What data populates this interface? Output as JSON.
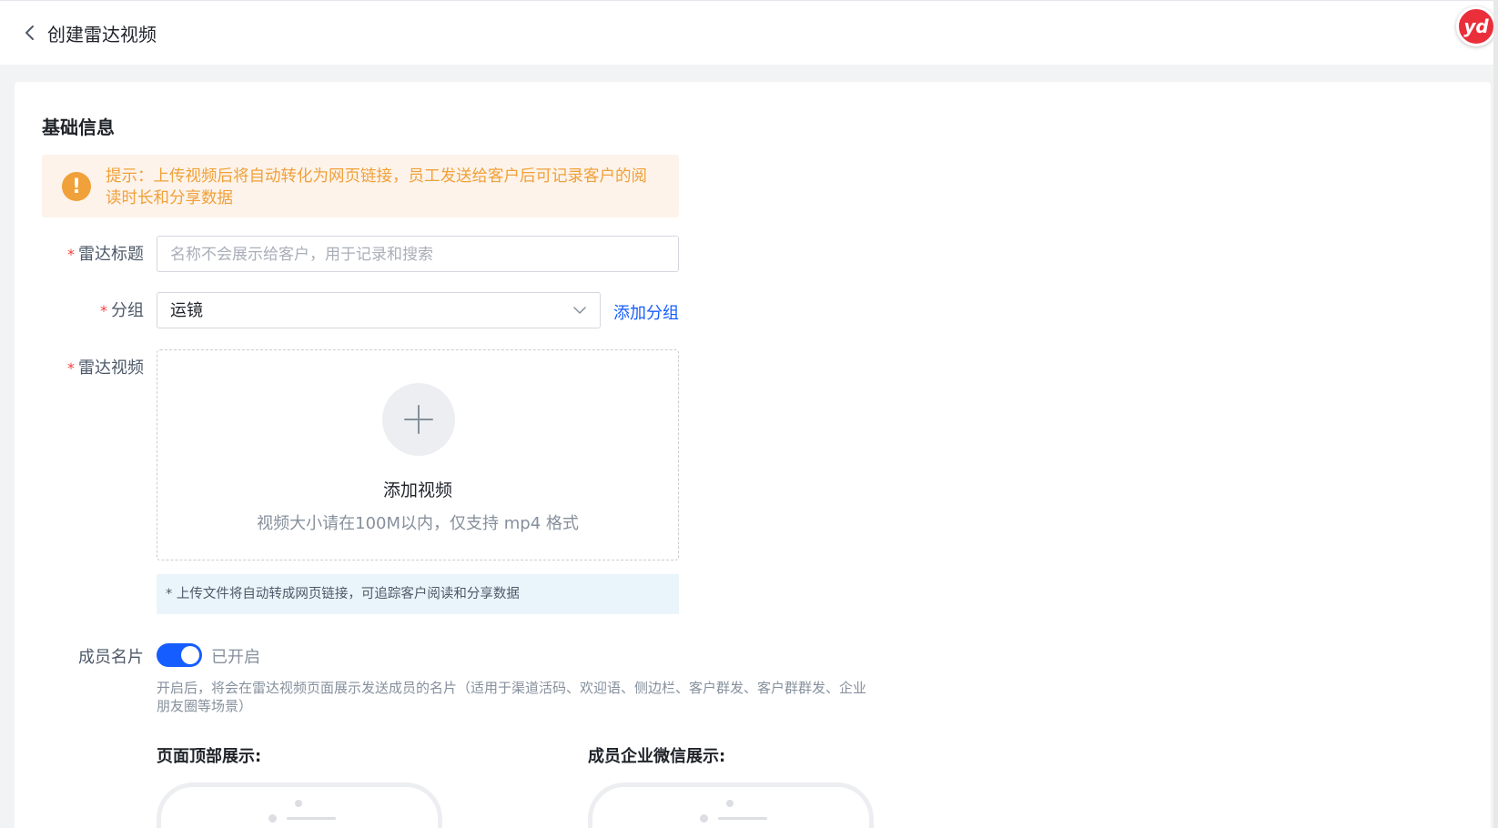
{
  "header": {
    "title": "创建雷达视频",
    "avatar_text": "yd"
  },
  "form": {
    "section_title": "基础信息",
    "tip": {
      "icon": "!",
      "text": "提示：上传视频后将自动转化为网页链接，员工发送给客户后可记录客户的阅读时长和分享数据"
    },
    "title_field": {
      "label": "雷达标题",
      "placeholder": "名称不会展示给客户，用于记录和搜索"
    },
    "group_field": {
      "label": "分组",
      "value": "运镜",
      "add_link": "添加分组"
    },
    "video_field": {
      "label": "雷达视频",
      "upload_title": "添加视频",
      "upload_hint": "视频大小请在100M以内，仅支持 mp4 格式",
      "info": "* 上传文件将自动转成网页链接，可追踪客户阅读和分享数据"
    },
    "member_card": {
      "label": "成员名片",
      "enabled": true,
      "status": "已开启",
      "description": "开启后，将会在雷达视频页面展示发送成员的名片（适用于渠道活码、欢迎语、侧边栏、客户群发、客户群群发、企业朋友圈等场景）"
    },
    "preview": {
      "top_title": "页面顶部展示:",
      "wecom_title": "成员企业微信展示:"
    }
  },
  "colors": {
    "accent": "#165dff",
    "warning": "#f0a13a",
    "required": "#f53f3f",
    "avatar": "#ea2f3b"
  },
  "icons": [
    "chevron-left-icon",
    "warning-icon",
    "chevron-down-icon",
    "plus-icon"
  ]
}
